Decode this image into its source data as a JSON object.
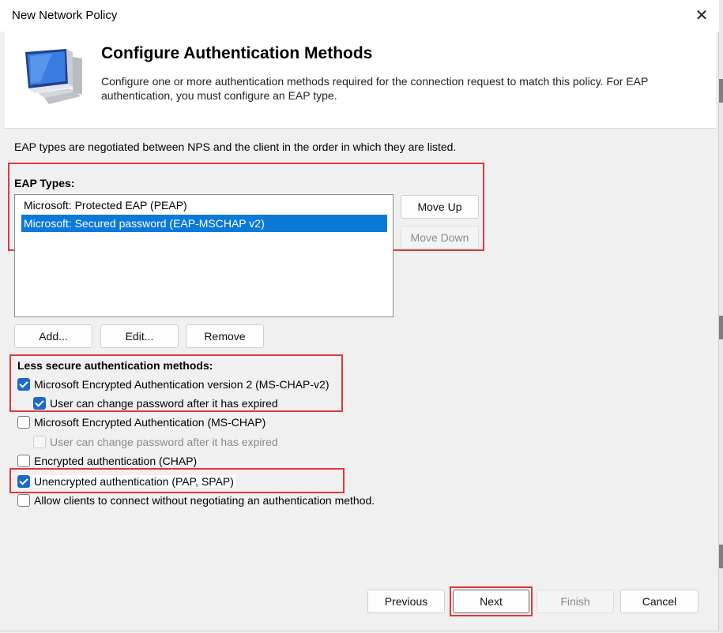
{
  "window": {
    "title": "New Network Policy",
    "close_glyph": "✕"
  },
  "header": {
    "icon": "computer-monitor-icon",
    "title": "Configure Authentication Methods",
    "description": "Configure one or more authentication methods required for the connection request to match this policy. For EAP authentication, you must configure an EAP type."
  },
  "intro_text": "EAP types are negotiated between NPS and the client in the order in which they are listed.",
  "eap": {
    "label": "EAP Types:",
    "items": [
      {
        "label": "Microsoft: Protected EAP (PEAP)",
        "selected": false
      },
      {
        "label": "Microsoft: Secured password (EAP-MSCHAP v2)",
        "selected": true
      }
    ],
    "move_up": "Move Up",
    "move_down": "Move Down",
    "add": "Add...",
    "edit": "Edit...",
    "remove": "Remove"
  },
  "less_secure": {
    "label": "Less secure authentication methods:",
    "options": [
      {
        "label": "Microsoft Encrypted Authentication version 2 (MS-CHAP-v2)",
        "checked": true
      },
      {
        "label": "User can change password after it has expired",
        "checked": true
      },
      {
        "label": "Microsoft Encrypted Authentication (MS-CHAP)",
        "checked": false
      },
      {
        "label": "User can change password after it has expired",
        "checked": false,
        "disabled": true
      },
      {
        "label": "Encrypted authentication (CHAP)",
        "checked": false
      },
      {
        "label": "Unencrypted authentication (PAP, SPAP)",
        "checked": true
      },
      {
        "label": "Allow clients to connect without negotiating an authentication method.",
        "checked": false
      }
    ]
  },
  "footer": {
    "previous": "Previous",
    "next": "Next",
    "finish": "Finish",
    "cancel": "Cancel"
  },
  "colors": {
    "highlight_box": "#e0373b",
    "selection": "#0a79d8",
    "checkbox_checked": "#1b6ac9"
  }
}
